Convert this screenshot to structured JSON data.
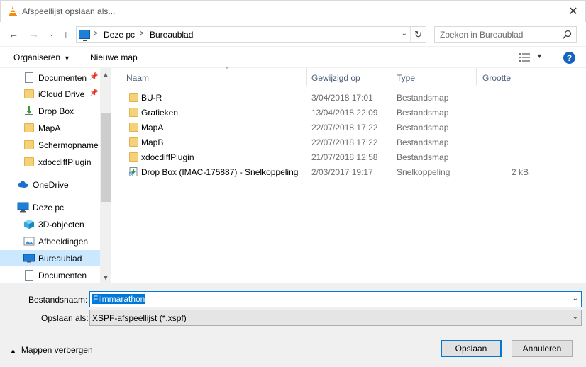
{
  "window": {
    "title": "Afspeellijst opslaan als..."
  },
  "address": {
    "crumbs": [
      "Deze pc",
      "Bureaublad"
    ]
  },
  "search": {
    "placeholder": "Zoeken in Bureaublad"
  },
  "commands": {
    "organize": "Organiseren",
    "new_folder": "Nieuwe map"
  },
  "nav": {
    "items": [
      {
        "label": "Documenten",
        "icon": "documents-icon",
        "pinned": true
      },
      {
        "label": "iCloud Drive",
        "icon": "folder-icon",
        "pinned": true
      },
      {
        "label": "Drop Box",
        "icon": "dropbox-folder-icon",
        "pinned": false
      },
      {
        "label": "MapA",
        "icon": "folder-icon",
        "pinned": false
      },
      {
        "label": "Schermopnamen",
        "icon": "folder-icon",
        "pinned": false
      },
      {
        "label": "xdocdiffPlugin",
        "icon": "folder-icon",
        "pinned": false
      },
      {
        "label": "OneDrive",
        "icon": "onedrive-icon",
        "pinned": false
      },
      {
        "label": "Deze pc",
        "icon": "pc-icon",
        "pinned": false
      },
      {
        "label": "3D-objecten",
        "icon": "3d-objects-icon",
        "pinned": false
      },
      {
        "label": "Afbeeldingen",
        "icon": "pictures-icon",
        "pinned": false
      },
      {
        "label": "Bureaublad",
        "icon": "desktop-icon",
        "pinned": false,
        "selected": true
      },
      {
        "label": "Documenten",
        "icon": "documents-icon",
        "pinned": false
      }
    ]
  },
  "columns": {
    "name": "Naam",
    "modified": "Gewijzigd op",
    "type": "Type",
    "size": "Grootte"
  },
  "files": [
    {
      "name": "BU-R",
      "modified": "3/04/2018 17:01",
      "type": "Bestandsmap",
      "size": ""
    },
    {
      "name": "Grafieken",
      "modified": "13/04/2018 22:09",
      "type": "Bestandsmap",
      "size": ""
    },
    {
      "name": "MapA",
      "modified": "22/07/2018 17:22",
      "type": "Bestandsmap",
      "size": ""
    },
    {
      "name": "MapB",
      "modified": "22/07/2018 17:22",
      "type": "Bestandsmap",
      "size": ""
    },
    {
      "name": "xdocdiffPlugin",
      "modified": "21/07/2018 12:58",
      "type": "Bestandsmap",
      "size": ""
    },
    {
      "name": "Drop Box (IMAC-175887) - Snelkoppeling",
      "modified": "2/03/2017 19:17",
      "type": "Snelkoppeling",
      "size": "2 kB"
    }
  ],
  "form": {
    "filename_label": "Bestandsnaam:",
    "filename_value": "Filmmarathon",
    "savetype_label": "Opslaan als:",
    "savetype_value": "XSPF-afspeellijst (*.xspf)"
  },
  "footer": {
    "hide_folders": "Mappen verbergen",
    "save": "Opslaan",
    "cancel": "Annuleren"
  },
  "colors": {
    "accent": "#0078d7",
    "selection": "#cce8ff",
    "folder": "#f5d27a",
    "help": "#1565c0"
  }
}
